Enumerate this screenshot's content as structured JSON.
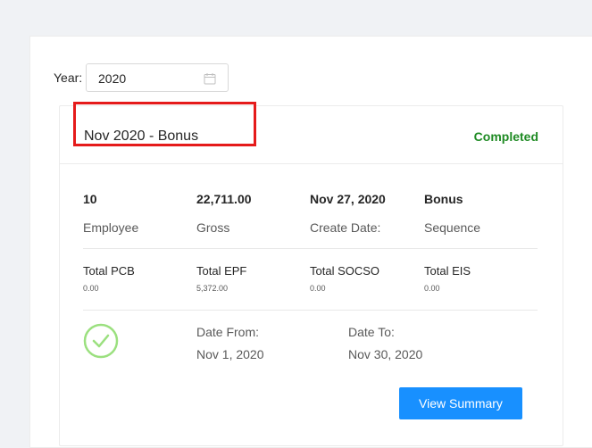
{
  "filter": {
    "year_label": "Year:",
    "year_value": "2020"
  },
  "card": {
    "title": "Nov 2020 - Bonus",
    "status": "Completed",
    "status_color": "#1f8b24",
    "stats": [
      {
        "value": "10",
        "label": "Employee"
      },
      {
        "value": "22,711.00",
        "label": "Gross"
      },
      {
        "value": "Nov 27, 2020",
        "label": "Create Date:"
      },
      {
        "value": "Bonus",
        "label": "Sequence"
      }
    ],
    "totals": [
      {
        "label": "Total PCB",
        "value": "0.00"
      },
      {
        "label": "Total EPF",
        "value": "5,372.00"
      },
      {
        "label": "Total SOCSO",
        "value": "0.00"
      },
      {
        "label": "Total EIS",
        "value": "0.00"
      }
    ],
    "date_from_label": "Date From:",
    "date_from_value": "Nov 1, 2020",
    "date_to_label": "Date To:",
    "date_to_value": "Nov 30, 2020",
    "button_label": "View Summary",
    "accent_color": "#1890ff"
  },
  "icons": {
    "calendar": "calendar-icon",
    "status": "check-circle-icon"
  }
}
